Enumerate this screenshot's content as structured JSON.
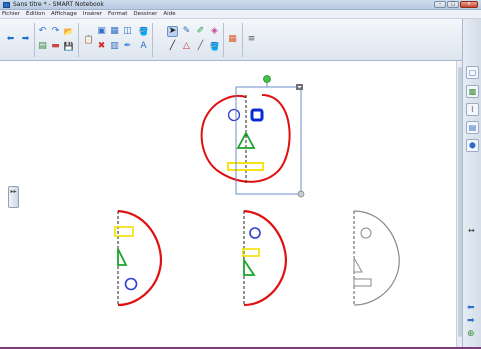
{
  "window": {
    "title": "Sans titre * - SMART Notebook",
    "controls": {
      "minimize": "–",
      "maximize": "□",
      "close": "x"
    }
  },
  "menubar": {
    "items": [
      "Fichier",
      "Édition",
      "Affichage",
      "Insérer",
      "Format",
      "Dessiner",
      "Aide"
    ]
  },
  "toolbar": {
    "tools": [
      {
        "name": "previous-page-icon",
        "glyph": "⬅",
        "color": "#1f6fd1"
      },
      {
        "name": "next-page-icon",
        "glyph": "➡",
        "color": "#1f6fd1"
      },
      {
        "name": "undo-icon",
        "glyph": "↶",
        "color": "#1f6fd1"
      },
      {
        "name": "redo-icon",
        "glyph": "↷",
        "color": "#1f6fd1"
      },
      {
        "name": "open-file-icon",
        "glyph": "📂",
        "color": "#d9a520"
      },
      {
        "name": "add-page-icon",
        "glyph": "▤",
        "color": "#1f6fd1"
      },
      {
        "name": "save-icon",
        "glyph": "💾",
        "color": "#2e6cc4"
      },
      {
        "name": "screen-shade-icon",
        "glyph": "▬",
        "color": "#2e6cc4"
      },
      {
        "name": "paste-icon",
        "glyph": "📋",
        "color": "#c49a3c"
      },
      {
        "name": "delete-icon",
        "glyph": "✖",
        "color": "#d42b2b"
      },
      {
        "name": "full-screen-icon",
        "glyph": "▣",
        "color": "#2e6cc4"
      },
      {
        "name": "table-icon",
        "glyph": "▦",
        "color": "#2e6cc4"
      },
      {
        "name": "doc-camera-icon",
        "glyph": "▥",
        "color": "#2e6cc4"
      },
      {
        "name": "screen-capture-icon",
        "glyph": "◫",
        "color": "#2e6cc4"
      },
      {
        "name": "select-icon",
        "glyph": "➤",
        "color": "#1d1d1d"
      },
      {
        "name": "pen-icon",
        "glyph": "✎",
        "color": "#2e6cc4"
      },
      {
        "name": "creative-pen-icon",
        "glyph": "✐",
        "color": "#22a04a"
      },
      {
        "name": "eraser-icon",
        "glyph": "◈",
        "color": "#c2469e"
      },
      {
        "name": "line-icon",
        "glyph": "╱",
        "color": "#1d1d1d"
      },
      {
        "name": "shapes-icon",
        "glyph": "△",
        "color": "#d42b2b"
      },
      {
        "name": "magic-pen-icon",
        "glyph": "✒",
        "color": "#3b82d6"
      },
      {
        "name": "fill-icon",
        "glyph": "🪣",
        "color": "#2e6cc4"
      },
      {
        "name": "text-icon",
        "glyph": "A",
        "color": "#2e6cc4"
      },
      {
        "name": "color-palette-icon",
        "glyph": "▦",
        "color": "#e05a2a"
      },
      {
        "name": "line-properties-icon",
        "glyph": "≡",
        "color": "#555555"
      },
      {
        "name": "settings-icon",
        "glyph": "⚙",
        "color": "#333333"
      },
      {
        "name": "move-toolbar-icon",
        "glyph": "⇕",
        "color": "#333333"
      }
    ]
  },
  "sidebar": {
    "buttons": [
      {
        "name": "page-sorter-icon",
        "glyph": "▢",
        "color": "#2e6cc4"
      },
      {
        "name": "gallery-icon",
        "glyph": "▩",
        "color": "#3e8f3e"
      },
      {
        "name": "attachments-icon",
        "glyph": "⌇",
        "color": "#555555"
      },
      {
        "name": "properties-icon",
        "glyph": "▤",
        "color": "#2e6cc4"
      },
      {
        "name": "addons-icon",
        "glyph": "⬢",
        "color": "#2e6cc4"
      }
    ],
    "mid_control": "↔",
    "bottom": [
      {
        "name": "arrow-left-icon",
        "glyph": "⬅"
      },
      {
        "name": "arrow-right-icon",
        "glyph": "➡"
      },
      {
        "name": "add-icon",
        "glyph": "⊕"
      }
    ]
  },
  "left_handle": {
    "glyph": "▸▸"
  }
}
